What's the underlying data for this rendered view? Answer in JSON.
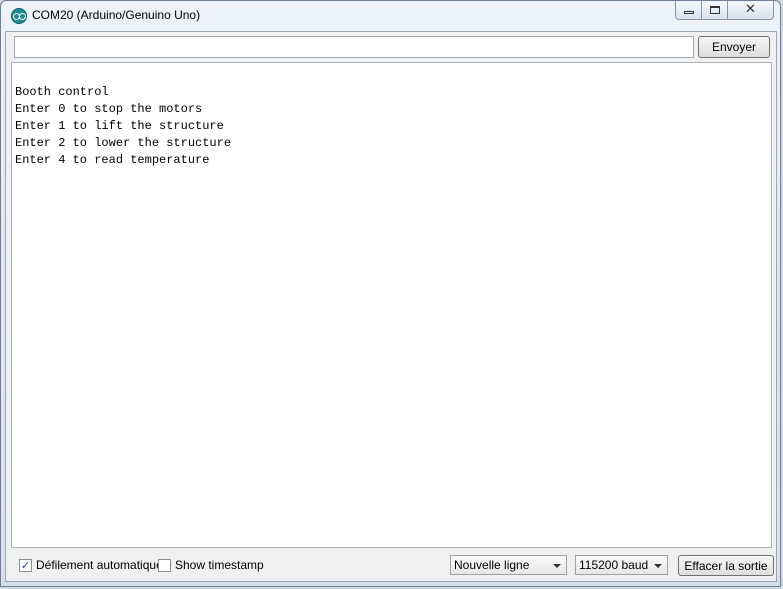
{
  "window": {
    "title": "COM20 (Arduino/Genuino Uno)",
    "controls": {
      "minimize": "minimize",
      "maximize": "maximize",
      "close": "✕"
    }
  },
  "send": {
    "input_value": "",
    "button_label": "Envoyer"
  },
  "output": {
    "lines": [
      "Booth control",
      "Enter 0 to stop the motors",
      "Enter 1 to lift the structure",
      "Enter 2 to lower the structure",
      "Enter 4 to read temperature"
    ]
  },
  "bottom": {
    "autoscroll": {
      "label": "Défilement automatique",
      "checked": true,
      "mark": "✓"
    },
    "timestamp": {
      "label": "Show timestamp",
      "checked": false
    },
    "line_ending": {
      "selected": "Nouvelle ligne"
    },
    "baud_rate": {
      "selected": "115200 baud"
    },
    "clear_label": "Effacer la sortie"
  },
  "icons": {
    "app": "arduino-logo-icon",
    "minimize": "minimize-icon",
    "maximize": "maximize-icon",
    "close": "close-icon",
    "dropdown": "chevron-down-icon"
  },
  "colors": {
    "app_icon": "#1e8b92",
    "window_frame": "#dfe8f2"
  }
}
